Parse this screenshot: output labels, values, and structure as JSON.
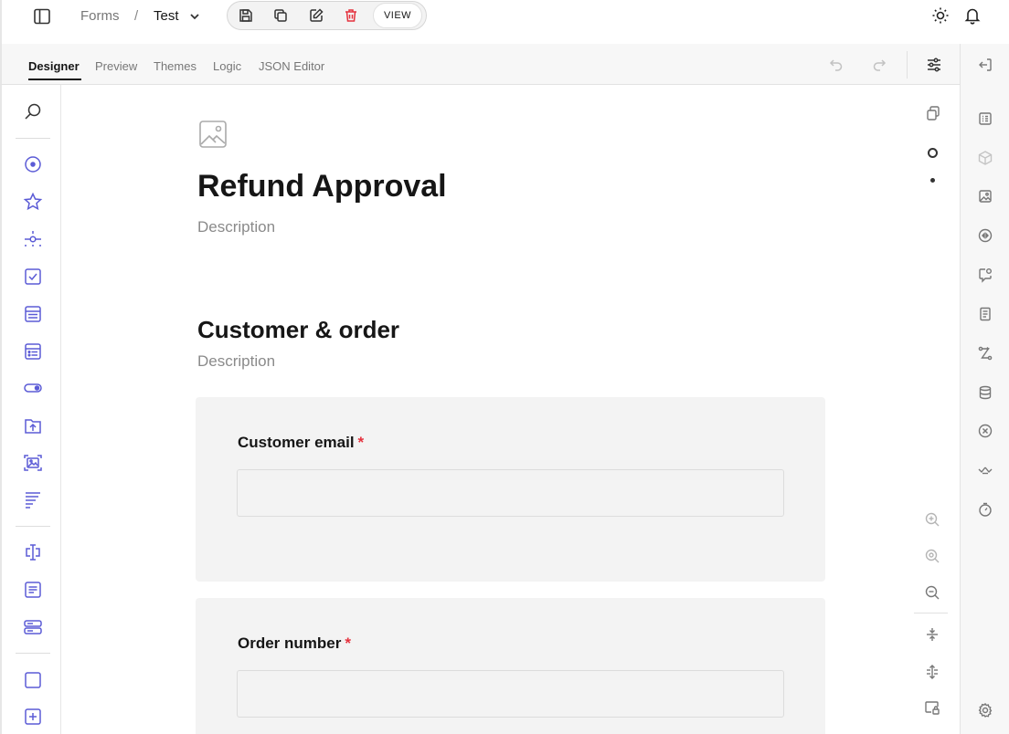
{
  "header": {
    "breadcrumb": {
      "root": "Forms",
      "separator": "/",
      "current": "Test"
    },
    "toolbar": {
      "view_label": "VIEW"
    },
    "icons": [
      "sidebar-toggle-icon",
      "chevron-down-icon",
      "save-icon",
      "copy-icon",
      "edit-icon",
      "trash-icon",
      "sun-icon",
      "bell-icon"
    ]
  },
  "tabs": [
    {
      "label": "Designer",
      "active": true
    },
    {
      "label": "Preview",
      "active": false
    },
    {
      "label": "Themes",
      "active": false
    },
    {
      "label": "Logic",
      "active": false
    },
    {
      "label": "JSON Editor",
      "active": false
    }
  ],
  "form": {
    "title": "Refund Approval",
    "description": "Description",
    "page": {
      "title": "Customer & order",
      "description": "Description"
    },
    "questions": [
      {
        "label": "Customer email",
        "required_mark": "*",
        "value": ""
      },
      {
        "label": "Order number",
        "required_mark": "*",
        "value": ""
      }
    ]
  },
  "colors": {
    "accent": "#5b5bd6",
    "required": "#e5323e",
    "delete": "#e5323e"
  }
}
